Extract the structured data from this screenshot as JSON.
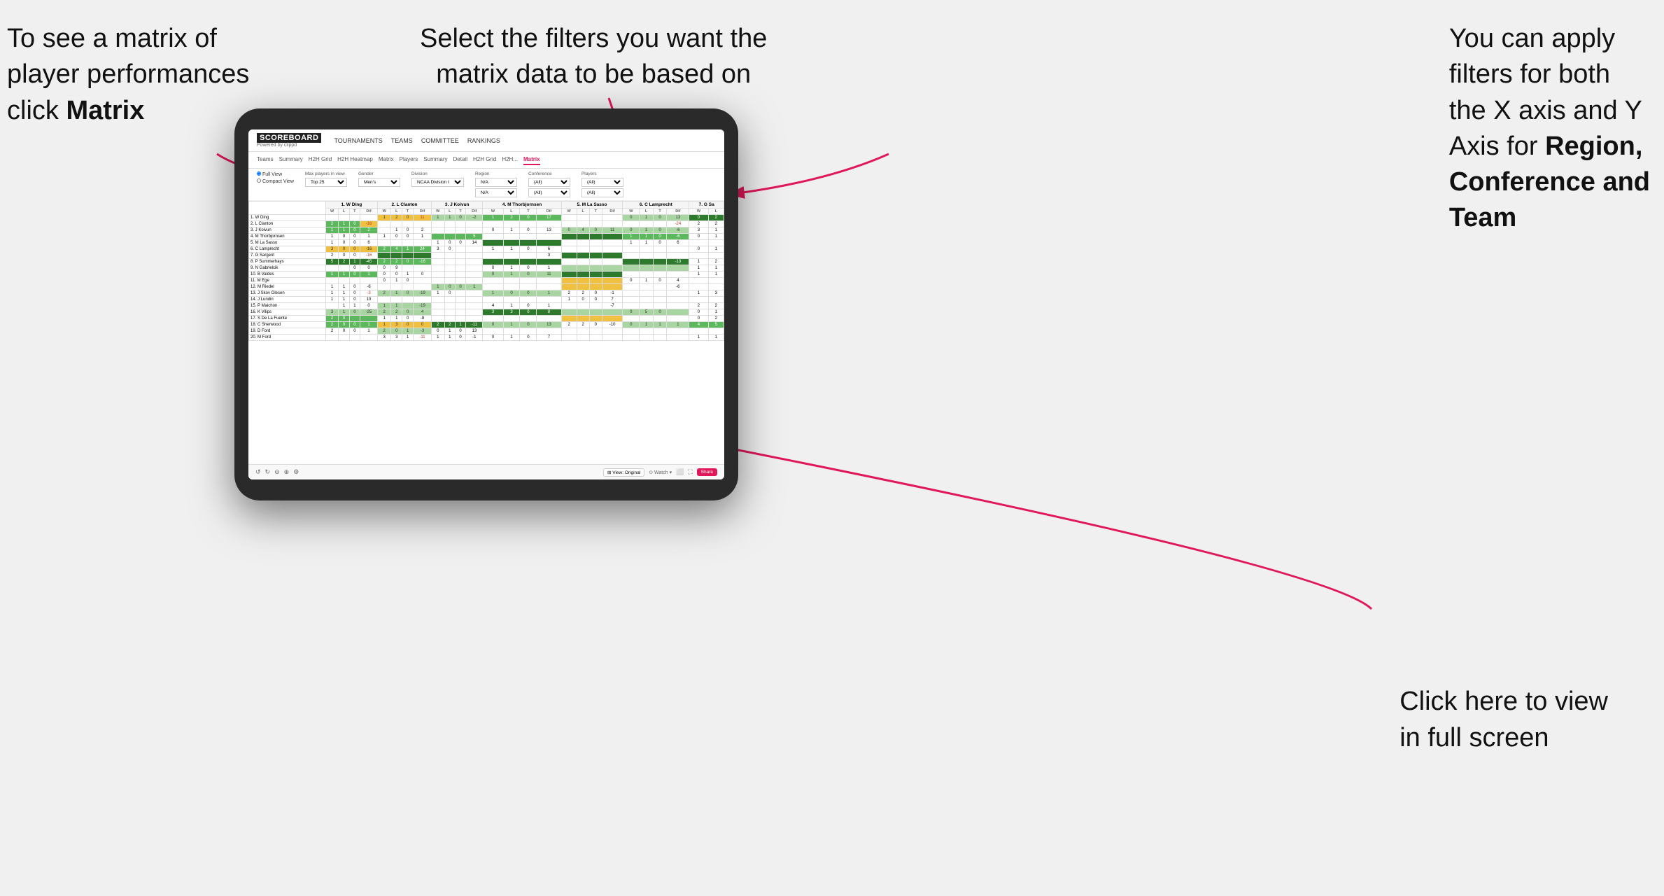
{
  "annotations": {
    "top_left": {
      "line1": "To see a matrix of",
      "line2": "player performances",
      "line3_prefix": "click ",
      "line3_bold": "Matrix"
    },
    "top_center": {
      "line1": "Select the filters you want the",
      "line2": "matrix data to be based on"
    },
    "top_right": {
      "line1": "You  can apply",
      "line2": "filters for both",
      "line3": "the X axis and Y",
      "line4_prefix": "Axis for ",
      "line4_bold": "Region,",
      "line5_bold": "Conference and",
      "line6_bold": "Team"
    },
    "bottom_right": {
      "line1": "Click here to view",
      "line2": "in full screen"
    }
  },
  "app": {
    "logo": "SCOREBOARD",
    "logo_sub": "Powered by clippd",
    "nav": [
      "TOURNAMENTS",
      "TEAMS",
      "COMMITTEE",
      "RANKINGS"
    ],
    "sub_nav": [
      "Teams",
      "Summary",
      "H2H Grid",
      "H2H Heatmap",
      "Matrix",
      "Players",
      "Summary",
      "Detail",
      "H2H Grid",
      "H2H...",
      "Matrix"
    ],
    "active_tab": "Matrix",
    "filters": {
      "view": [
        "Full View",
        "Compact View"
      ],
      "max_players": {
        "label": "Max players in view",
        "value": "Top 25"
      },
      "gender": {
        "label": "Gender",
        "value": "Men's"
      },
      "division": {
        "label": "Division",
        "value": "NCAA Division I"
      },
      "region": {
        "label": "Region",
        "values": [
          "N/A",
          "N/A"
        ]
      },
      "conference": {
        "label": "Conference",
        "values": [
          "(All)",
          "(All)"
        ]
      },
      "players": {
        "label": "Players",
        "values": [
          "(All)",
          "(All)"
        ]
      }
    },
    "column_headers": [
      "1. W Ding",
      "2. L Clanton",
      "3. J Koivun",
      "4. M Thorbjornsen",
      "5. M La Sasso",
      "6. C Lamprecht",
      "7. G Sa"
    ],
    "sub_cols": [
      "W",
      "L",
      "T",
      "Dif"
    ],
    "rows": [
      {
        "name": "1. W Ding"
      },
      {
        "name": "2. L Clanton"
      },
      {
        "name": "3. J Koivun"
      },
      {
        "name": "4. M Thorbjornsen"
      },
      {
        "name": "5. M La Sasso"
      },
      {
        "name": "6. C Lamprecht"
      },
      {
        "name": "7. G Sargent"
      },
      {
        "name": "8. P Summerhays"
      },
      {
        "name": "9. N Gabrielcik"
      },
      {
        "name": "10. B Valdes"
      },
      {
        "name": "11. M Ege"
      },
      {
        "name": "12. M Riedel"
      },
      {
        "name": "13. J Skov Olesen"
      },
      {
        "name": "14. J Lundin"
      },
      {
        "name": "15. P Maichon"
      },
      {
        "name": "16. K Vilips"
      },
      {
        "name": "17. S De La Fuente"
      },
      {
        "name": "18. C Sherwood"
      },
      {
        "name": "19. D Ford"
      },
      {
        "name": "20. M Ford"
      }
    ],
    "toolbar": {
      "view_label": "⊞ View: Original",
      "watch_label": "⊙ Watch ▾",
      "share_label": "Share"
    }
  }
}
